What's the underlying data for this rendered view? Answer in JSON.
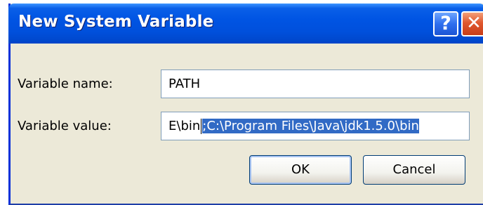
{
  "window": {
    "title": "New System Variable",
    "help_button_label": "?",
    "close_button_label": "✕"
  },
  "form": {
    "name_label": "Variable name:",
    "name_value": "PATH",
    "value_label": "Variable value:",
    "value_unselected": "E\\bin",
    "value_selected": ";C:\\Program Files\\Java\\jdk1.5.0\\bin"
  },
  "buttons": {
    "ok_label": "OK",
    "cancel_label": "Cancel"
  },
  "colors": {
    "titlebar": "#0054e3",
    "dialog_background": "#ece9d8",
    "selection": "#316ac5",
    "close_button": "#e0582f"
  }
}
